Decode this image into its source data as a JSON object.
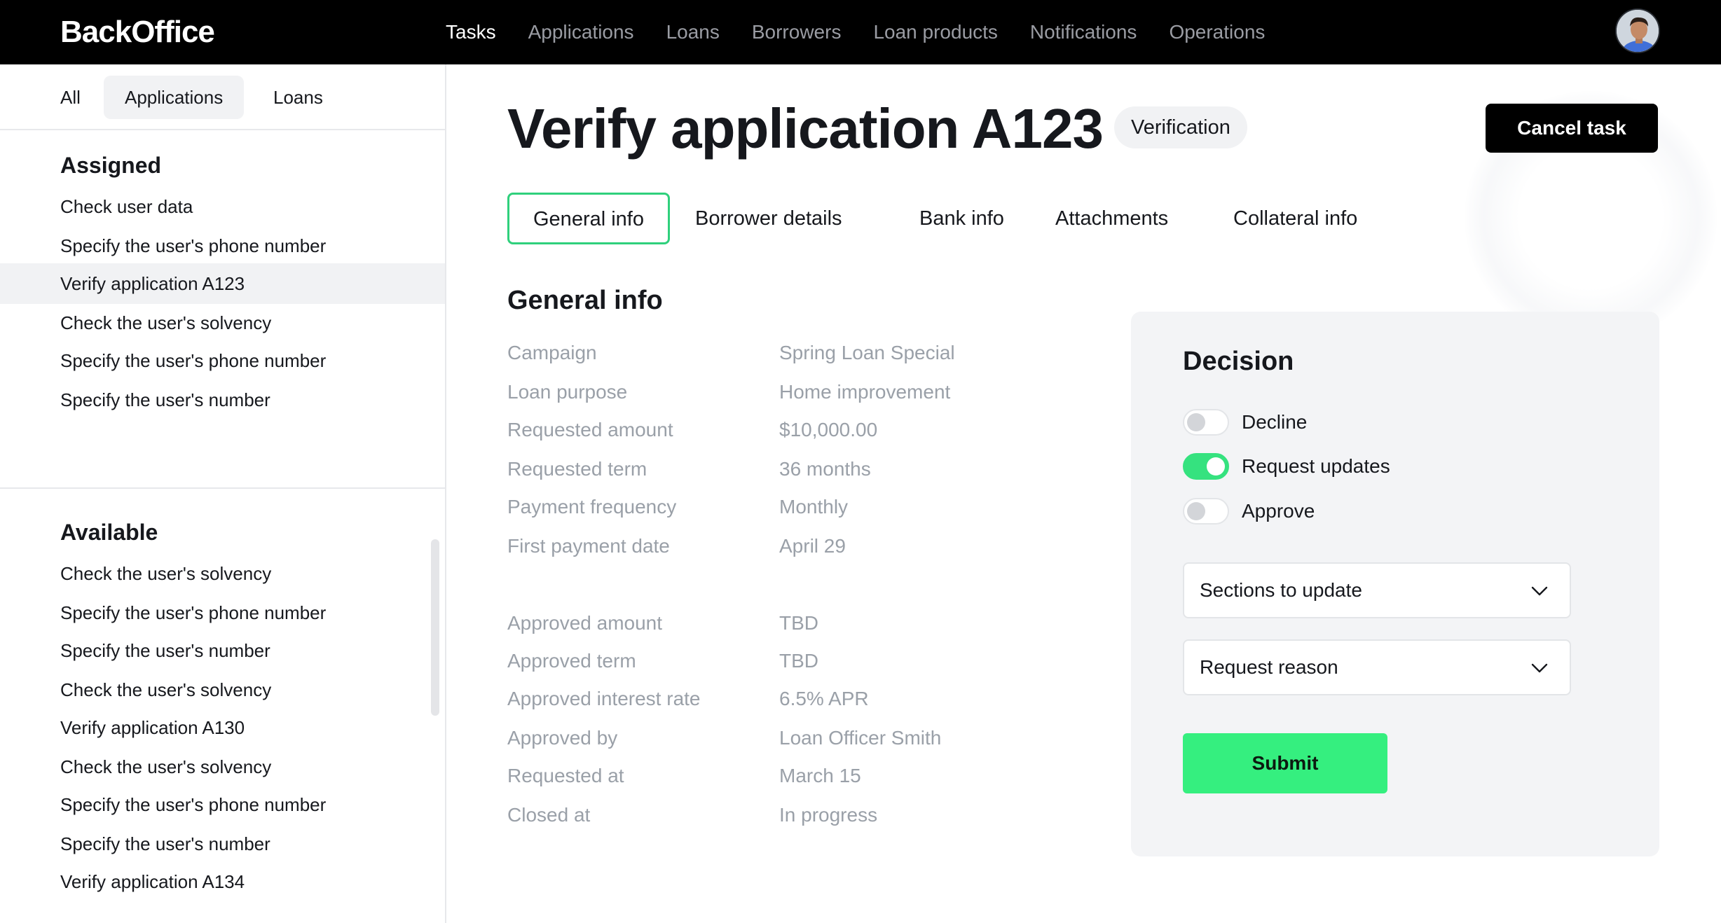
{
  "app": {
    "brand": "BackOffice",
    "nav": [
      {
        "label": "Tasks",
        "active": true
      },
      {
        "label": "Applications",
        "active": false
      },
      {
        "label": "Loans",
        "active": false
      },
      {
        "label": "Borrowers",
        "active": false
      },
      {
        "label": "Loan products",
        "active": false
      },
      {
        "label": "Notifications",
        "active": false
      },
      {
        "label": "Operations",
        "active": false
      }
    ]
  },
  "sidebar": {
    "tabs": [
      {
        "label": "All",
        "active": false
      },
      {
        "label": "Applications",
        "active": true
      },
      {
        "label": "Loans",
        "active": false
      }
    ],
    "assigned_title": "Assigned",
    "assigned": [
      {
        "label": "Check user data",
        "selected": false
      },
      {
        "label": "Specify the user's phone number",
        "selected": false
      },
      {
        "label": "Verify application A123",
        "selected": true
      },
      {
        "label": "Check the user's solvency",
        "selected": false
      },
      {
        "label": "Specify the user's phone number",
        "selected": false
      },
      {
        "label": "Specify the user's number",
        "selected": false
      }
    ],
    "available_title": "Available",
    "available": [
      {
        "label": "Check the user's solvency"
      },
      {
        "label": "Specify the user's phone number"
      },
      {
        "label": "Specify the user's number"
      },
      {
        "label": "Check the user's solvency"
      },
      {
        "label": "Verify application A130"
      },
      {
        "label": "Check the user's solvency"
      },
      {
        "label": "Specify the user's phone number"
      },
      {
        "label": "Specify the user's number"
      },
      {
        "label": "Verify application A134"
      }
    ]
  },
  "main": {
    "title": "Verify application A123",
    "status_badge": "Verification",
    "cancel_label": "Cancel task",
    "tabs": [
      {
        "label": "General info",
        "active": true
      },
      {
        "label": "Borrower details",
        "active": false
      },
      {
        "label": "Bank info",
        "active": false
      },
      {
        "label": "Attachments",
        "active": false
      },
      {
        "label": "Collateral info",
        "active": false
      }
    ],
    "section_heading": "General info",
    "fields": [
      {
        "label": "Campaign",
        "value": "Spring Loan Special"
      },
      {
        "label": "Loan purpose",
        "value": "Home improvement"
      },
      {
        "label": "Requested amount",
        "value": "$10,000.00"
      },
      {
        "label": "Requested term",
        "value": "36 months"
      },
      {
        "label": "Payment frequency",
        "value": "Monthly"
      },
      {
        "label": "First payment date",
        "value": "April 29"
      },
      {
        "label": "Approved amount",
        "value": "TBD"
      },
      {
        "label": "Approved term",
        "value": "TBD"
      },
      {
        "label": "Approved interest rate",
        "value": "6.5% APR"
      },
      {
        "label": "Approved by",
        "value": "Loan Officer Smith"
      },
      {
        "label": "Requested at",
        "value": "March 15"
      },
      {
        "label": "Closed at",
        "value": "In progress"
      }
    ]
  },
  "decision": {
    "title": "Decision",
    "options": [
      {
        "label": "Decline",
        "on": false
      },
      {
        "label": "Request updates",
        "on": true
      },
      {
        "label": "Approve",
        "on": false
      }
    ],
    "sections_select": "Sections to update",
    "reason_select": "Request reason",
    "submit_label": "Submit"
  },
  "colors": {
    "accent_green": "#35ef7f",
    "tab_border_green": "#2fd07c",
    "topbar": "#000000"
  }
}
